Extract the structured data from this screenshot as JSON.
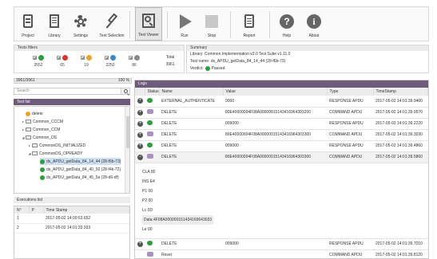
{
  "toolbar": {
    "items": [
      {
        "label": "Project",
        "icon": "project-icon"
      },
      {
        "label": "Library",
        "icon": "library-icon"
      },
      {
        "label": "Settings",
        "icon": "gear-icon"
      },
      {
        "label": "Test Selection",
        "icon": "pin-icon"
      },
      {
        "label": "Test Viewer",
        "icon": "viewer-icon"
      },
      {
        "label": "Run",
        "icon": "play-icon"
      },
      {
        "label": "Stop",
        "icon": "stop-icon"
      },
      {
        "label": "Report",
        "icon": "report-icon"
      },
      {
        "label": "Help",
        "icon": "help-icon"
      },
      {
        "label": "About",
        "icon": "info-icon"
      }
    ]
  },
  "filters": {
    "title": "Tests filters",
    "chips": [
      {
        "value": "3552",
        "color": "#2e9e3e"
      },
      {
        "value": "65",
        "color": "#d9342b"
      },
      {
        "value": "19",
        "color": "#f0a030"
      },
      {
        "value": "2250",
        "color": "#3a86c8"
      },
      {
        "value": "86",
        "color": "#8a8a8a"
      }
    ],
    "total_label": "Total",
    "total_value": "3961"
  },
  "summary": {
    "title": "Summary",
    "library": "Library: Common Implementation v2.0 Test Suite v1.11.0",
    "test_name": "Test name: ds_APDU_getData_84_14_44 (28-f6b-73)",
    "verdict_label": "Verdict:",
    "verdict": "Passed"
  },
  "progress": {
    "left": "3961/3961",
    "right": "100 %",
    "fraction": 1.0
  },
  "search": {
    "placeholder": "Search"
  },
  "test_list": {
    "title": "Test list",
    "nodes": [
      {
        "label": "delete",
        "kind": "warn"
      },
      {
        "label": "Common_CCCM",
        "kind": "folder"
      },
      {
        "label": "Common_CCM",
        "kind": "folder"
      },
      {
        "label": "Common_DS",
        "kind": "folder"
      },
      {
        "label": "CommonDS_INITIALIZED",
        "kind": "folder"
      },
      {
        "label": "CommonDS_OPREADY",
        "kind": "folder"
      },
      {
        "label": "ds_APDU_getData_84_14_44 (28-f6b-73)",
        "kind": "pass"
      },
      {
        "label": "ds_APDU_getData_84_40_92 (28-f4k-72)",
        "kind": "pass"
      },
      {
        "label": "ds_APDU_getData_84_45_5a (28-d6-df)",
        "kind": "pass"
      }
    ]
  },
  "executions": {
    "title": "Executions list",
    "headers": [
      "N°",
      "P",
      "Time Stamp"
    ],
    "rows": [
      {
        "n": "1",
        "time": "2017-05-02 14:00:53.652"
      },
      {
        "n": "2",
        "time": "2017-05-02 14:01:33.933"
      }
    ]
  },
  "log": {
    "title": "Logs",
    "headers": [
      "",
      "Status",
      "Name",
      "Value",
      "Type",
      "TimeStamp"
    ],
    "rows": [
      {
        "name": "EXTERNAL_AUTHENTICATE",
        "value": "9000",
        "type": "RESPONSE APDU",
        "time": "2017-05-02 14:01:39.9400",
        "status": "ok"
      },
      {
        "name": "DELETE",
        "value": "80E40000004F08A00000015143416964303200",
        "type": "COMMAND APDU",
        "time": "2017-05-02 14:01:39.0570",
        "status": "cmd"
      },
      {
        "name": "DELETE",
        "value": "009000",
        "type": "RESPONSE APDU",
        "time": "2017-05-02 14:01:39.2220",
        "status": "ok"
      },
      {
        "name": "DELETE",
        "value": "80E40000004F08A00000015143416964303300",
        "type": "COMMAND APDU",
        "time": "2017-05-02 14:01:39.3030",
        "status": "cmd"
      },
      {
        "name": "DELETE",
        "value": "009000",
        "type": "RESPONSE APDU",
        "time": "2017-05-02 14:01:39.4860",
        "status": "ok"
      },
      {
        "name": "DELETE",
        "value": "80E40000004F08A00000015143416964303300",
        "type": "COMMAND APDU",
        "time": "2017-05-02 14:01:39.5860",
        "status": "cmd"
      }
    ],
    "detail": {
      "cla": "CLA  80",
      "ins": "INS  E4",
      "p1": "P1   00",
      "p2": "P2   00",
      "lc": "Lc   0D",
      "data": "Data  4F08A000000151434169643033",
      "le": "Le   00"
    },
    "rows_after": [
      {
        "name": "DELETE",
        "value": "009000",
        "type": "RESPONSE APDU",
        "time": "2017-05-02 14:01:39.7010",
        "status": "ok"
      },
      {
        "name": "Reset",
        "value": "",
        "type": "COMMAND APDU",
        "time": "2017-05-02 14:01:39.8120",
        "status": "cmd"
      }
    ]
  }
}
